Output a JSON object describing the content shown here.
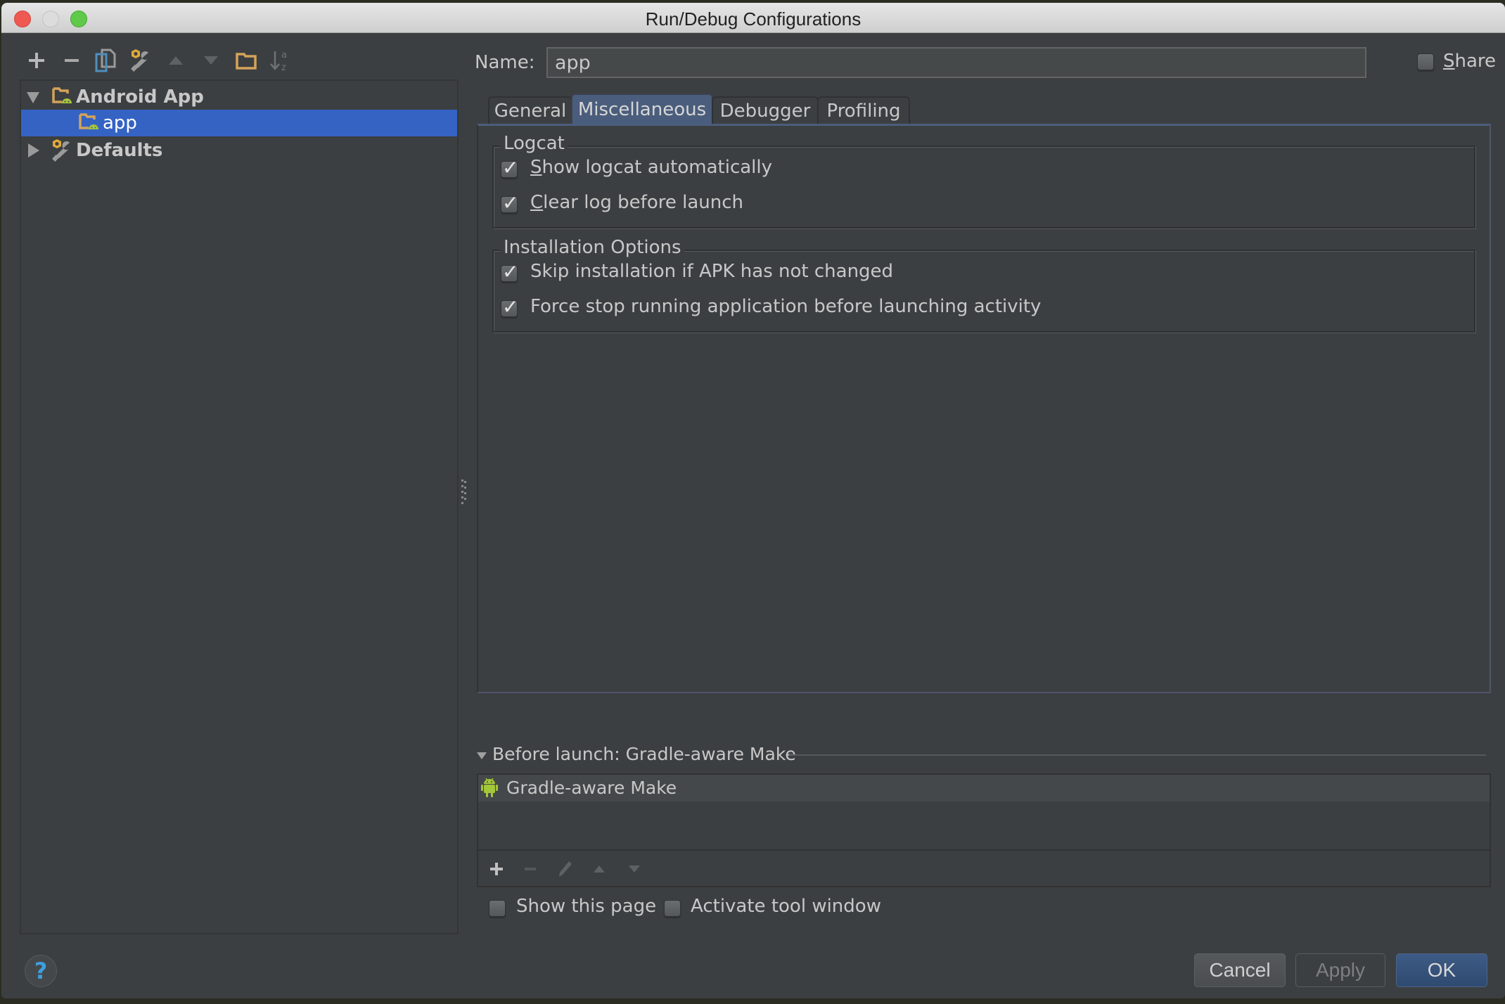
{
  "window": {
    "title": "Run/Debug Configurations",
    "controls": [
      "close",
      "minimize",
      "maximize"
    ]
  },
  "toolbar": {
    "icons": [
      {
        "name": "add-icon",
        "glyph": "+"
      },
      {
        "name": "remove-icon",
        "glyph": "−"
      },
      {
        "name": "copy-icon",
        "glyph": "copy"
      },
      {
        "name": "edit-defaults-icon",
        "glyph": "wrench"
      },
      {
        "name": "move-up-icon",
        "glyph": "▲"
      },
      {
        "name": "move-down-icon",
        "glyph": "▼"
      },
      {
        "name": "folder-icon",
        "glyph": "folder"
      },
      {
        "name": "sort-icon",
        "glyph": "↓az"
      }
    ]
  },
  "tree": {
    "items": [
      {
        "label": "Android App",
        "level": 0,
        "expanded": true,
        "icon": "android-folder-icon"
      },
      {
        "label": "app",
        "level": 1,
        "selected": true,
        "icon": "android-folder-icon"
      },
      {
        "label": "Defaults",
        "level": 0,
        "expanded": false,
        "icon": "wrench-icon"
      }
    ]
  },
  "name": {
    "label": "Name:",
    "value": "app"
  },
  "share": {
    "label_first": "S",
    "label_rest": "hare",
    "checked": false
  },
  "tabs": [
    {
      "label": "General",
      "active": false
    },
    {
      "label": "Miscellaneous",
      "active": true
    },
    {
      "label": "Debugger",
      "active": false
    },
    {
      "label": "Profiling",
      "active": false
    }
  ],
  "logcat": {
    "title": "Logcat",
    "options": [
      {
        "mnemonic": "S",
        "rest": "how logcat automatically",
        "checked": true
      },
      {
        "mnemonic": "C",
        "rest": "lear log before launch",
        "checked": true
      }
    ]
  },
  "installation": {
    "title": "Installation Options",
    "options": [
      {
        "label": "Skip installation if APK has not changed",
        "checked": true
      },
      {
        "label": "Force stop running application before launching activity",
        "checked": true
      }
    ]
  },
  "before_launch": {
    "title": "Before launch: Gradle-aware Make",
    "items": [
      {
        "label": "Gradle-aware Make",
        "icon": "android-icon"
      }
    ],
    "toolbar": [
      "add-icon",
      "remove-icon",
      "edit-icon",
      "move-up-icon",
      "move-down-icon"
    ]
  },
  "bottom_options": {
    "show_page": {
      "label": "Show this page",
      "checked": false
    },
    "activate_tool": {
      "label": "Activate tool window",
      "checked": false
    }
  },
  "buttons": {
    "help": "?",
    "cancel": "Cancel",
    "apply": "Apply",
    "ok": "OK"
  },
  "colors": {
    "background": "#3c3f41",
    "selection": "#3563c4",
    "active_tab": "#4a5d7c",
    "ok_button": "#34507a",
    "android_green": "#a4c639",
    "folder_orange": "#d4a35a",
    "help_blue": "#3d9ee0"
  }
}
